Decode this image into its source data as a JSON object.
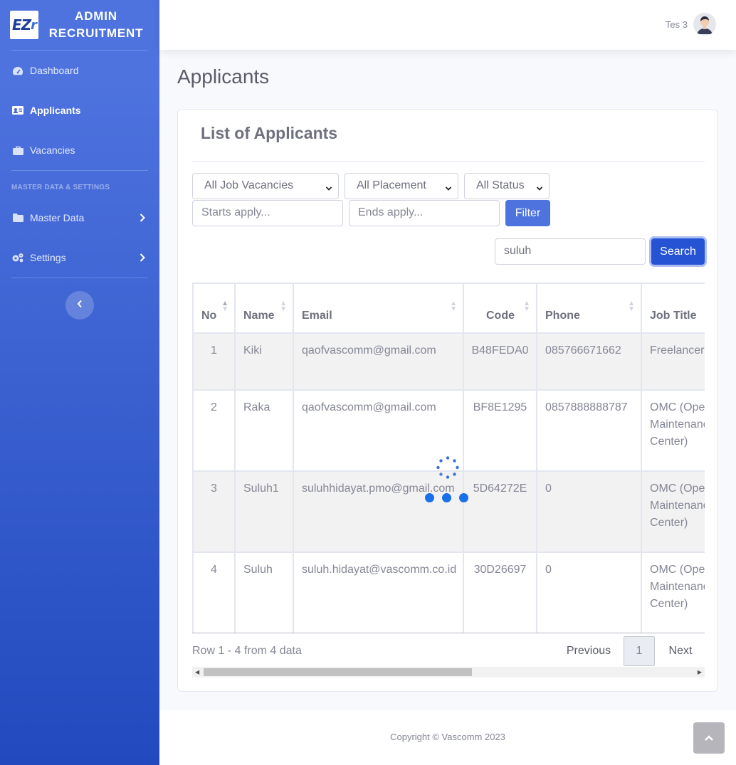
{
  "brand": {
    "logo_text": "EZ",
    "logo_r": "r",
    "line1": "ADMIN",
    "line2": "RECRUITMENT"
  },
  "sidebar": {
    "items": [
      {
        "label": "Dashboard",
        "icon": "tachometer-icon"
      },
      {
        "label": "Applicants",
        "icon": "id-card-icon",
        "active": true
      },
      {
        "label": "Vacancies",
        "icon": "briefcase-icon"
      }
    ],
    "heading": "MASTER DATA & SETTINGS",
    "sub_items": [
      {
        "label": "Master Data",
        "icon": "folder-icon"
      },
      {
        "label": "Settings",
        "icon": "gears-icon"
      }
    ]
  },
  "topbar": {
    "user_name": "Tes 3"
  },
  "page": {
    "title": "Applicants"
  },
  "card": {
    "title": "List of Applicants"
  },
  "filters": {
    "job_vacancy": "All Job Vacancies",
    "placement": "All Placement",
    "status": "All Status",
    "starts_placeholder": "Starts apply...",
    "ends_placeholder": "Ends apply...",
    "filter_label": "Filter"
  },
  "search": {
    "value": "suluh",
    "button_label": "Search"
  },
  "table": {
    "columns": [
      "No",
      "Name",
      "Email",
      "Code",
      "Phone",
      "Job Title"
    ],
    "rows": [
      {
        "no": "1",
        "name": "Kiki",
        "email": "qaofvascomm@gmail.com",
        "code": "B48FEDA0",
        "phone": "085766671662",
        "job_title": "Freelancer UI/UX"
      },
      {
        "no": "2",
        "name": "Raka",
        "email": "qaofvascomm@gmail.com",
        "code": "BF8E1295",
        "phone": "0857888888787",
        "job_title": "OMC (Operation Maintenance Center)"
      },
      {
        "no": "3",
        "name": "Suluh1",
        "email": "suluhhidayat.pmo@gmail.com",
        "code": "5D64272E",
        "phone": "0",
        "job_title": "OMC (Operation Maintenance Center)"
      },
      {
        "no": "4",
        "name": "Suluh",
        "email": "suluh.hidayat@vascomm.co.id",
        "code": "30D26697",
        "phone": "0",
        "job_title": "OMC (Operation Maintenance Center)"
      }
    ]
  },
  "pagination": {
    "info": "Row 1 - 4 from 4 data",
    "previous": "Previous",
    "page": "1",
    "next": "Next"
  },
  "footer": {
    "copyright": "Copyright © Vascomm 2023"
  },
  "colors": {
    "sidebar_start": "#4e73df",
    "sidebar_end": "#224abe",
    "primary": "#4e73df",
    "loader": "#1a6fea"
  }
}
